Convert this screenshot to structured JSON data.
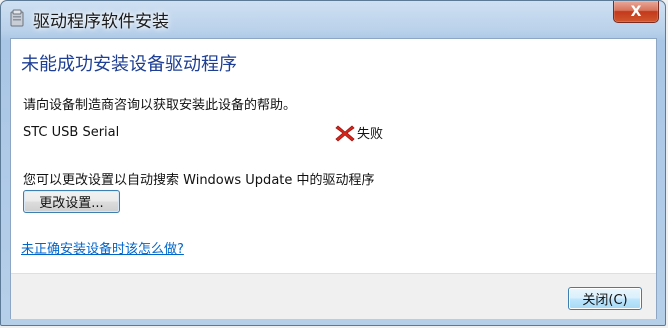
{
  "window": {
    "title": "驱动程序软件安装",
    "close_glyph": "X"
  },
  "main": {
    "headline": "未能成功安装设备驱动程序",
    "description": "请向设备制造商咨询以获取安装此设备的帮助。",
    "device": {
      "name": "STC USB Serial",
      "status_icon": "error-x-icon",
      "status": "失败"
    },
    "hint": "您可以更改设置以自动搜索 Windows Update 中的驱动程序",
    "change_settings_label": "更改设置...",
    "help_link": "未正确安装设备时该怎么做?"
  },
  "footer": {
    "close_label": "关闭(C)"
  },
  "colors": {
    "headline": "#1e3f94",
    "link": "#0066cc",
    "error": "#d9261c"
  }
}
